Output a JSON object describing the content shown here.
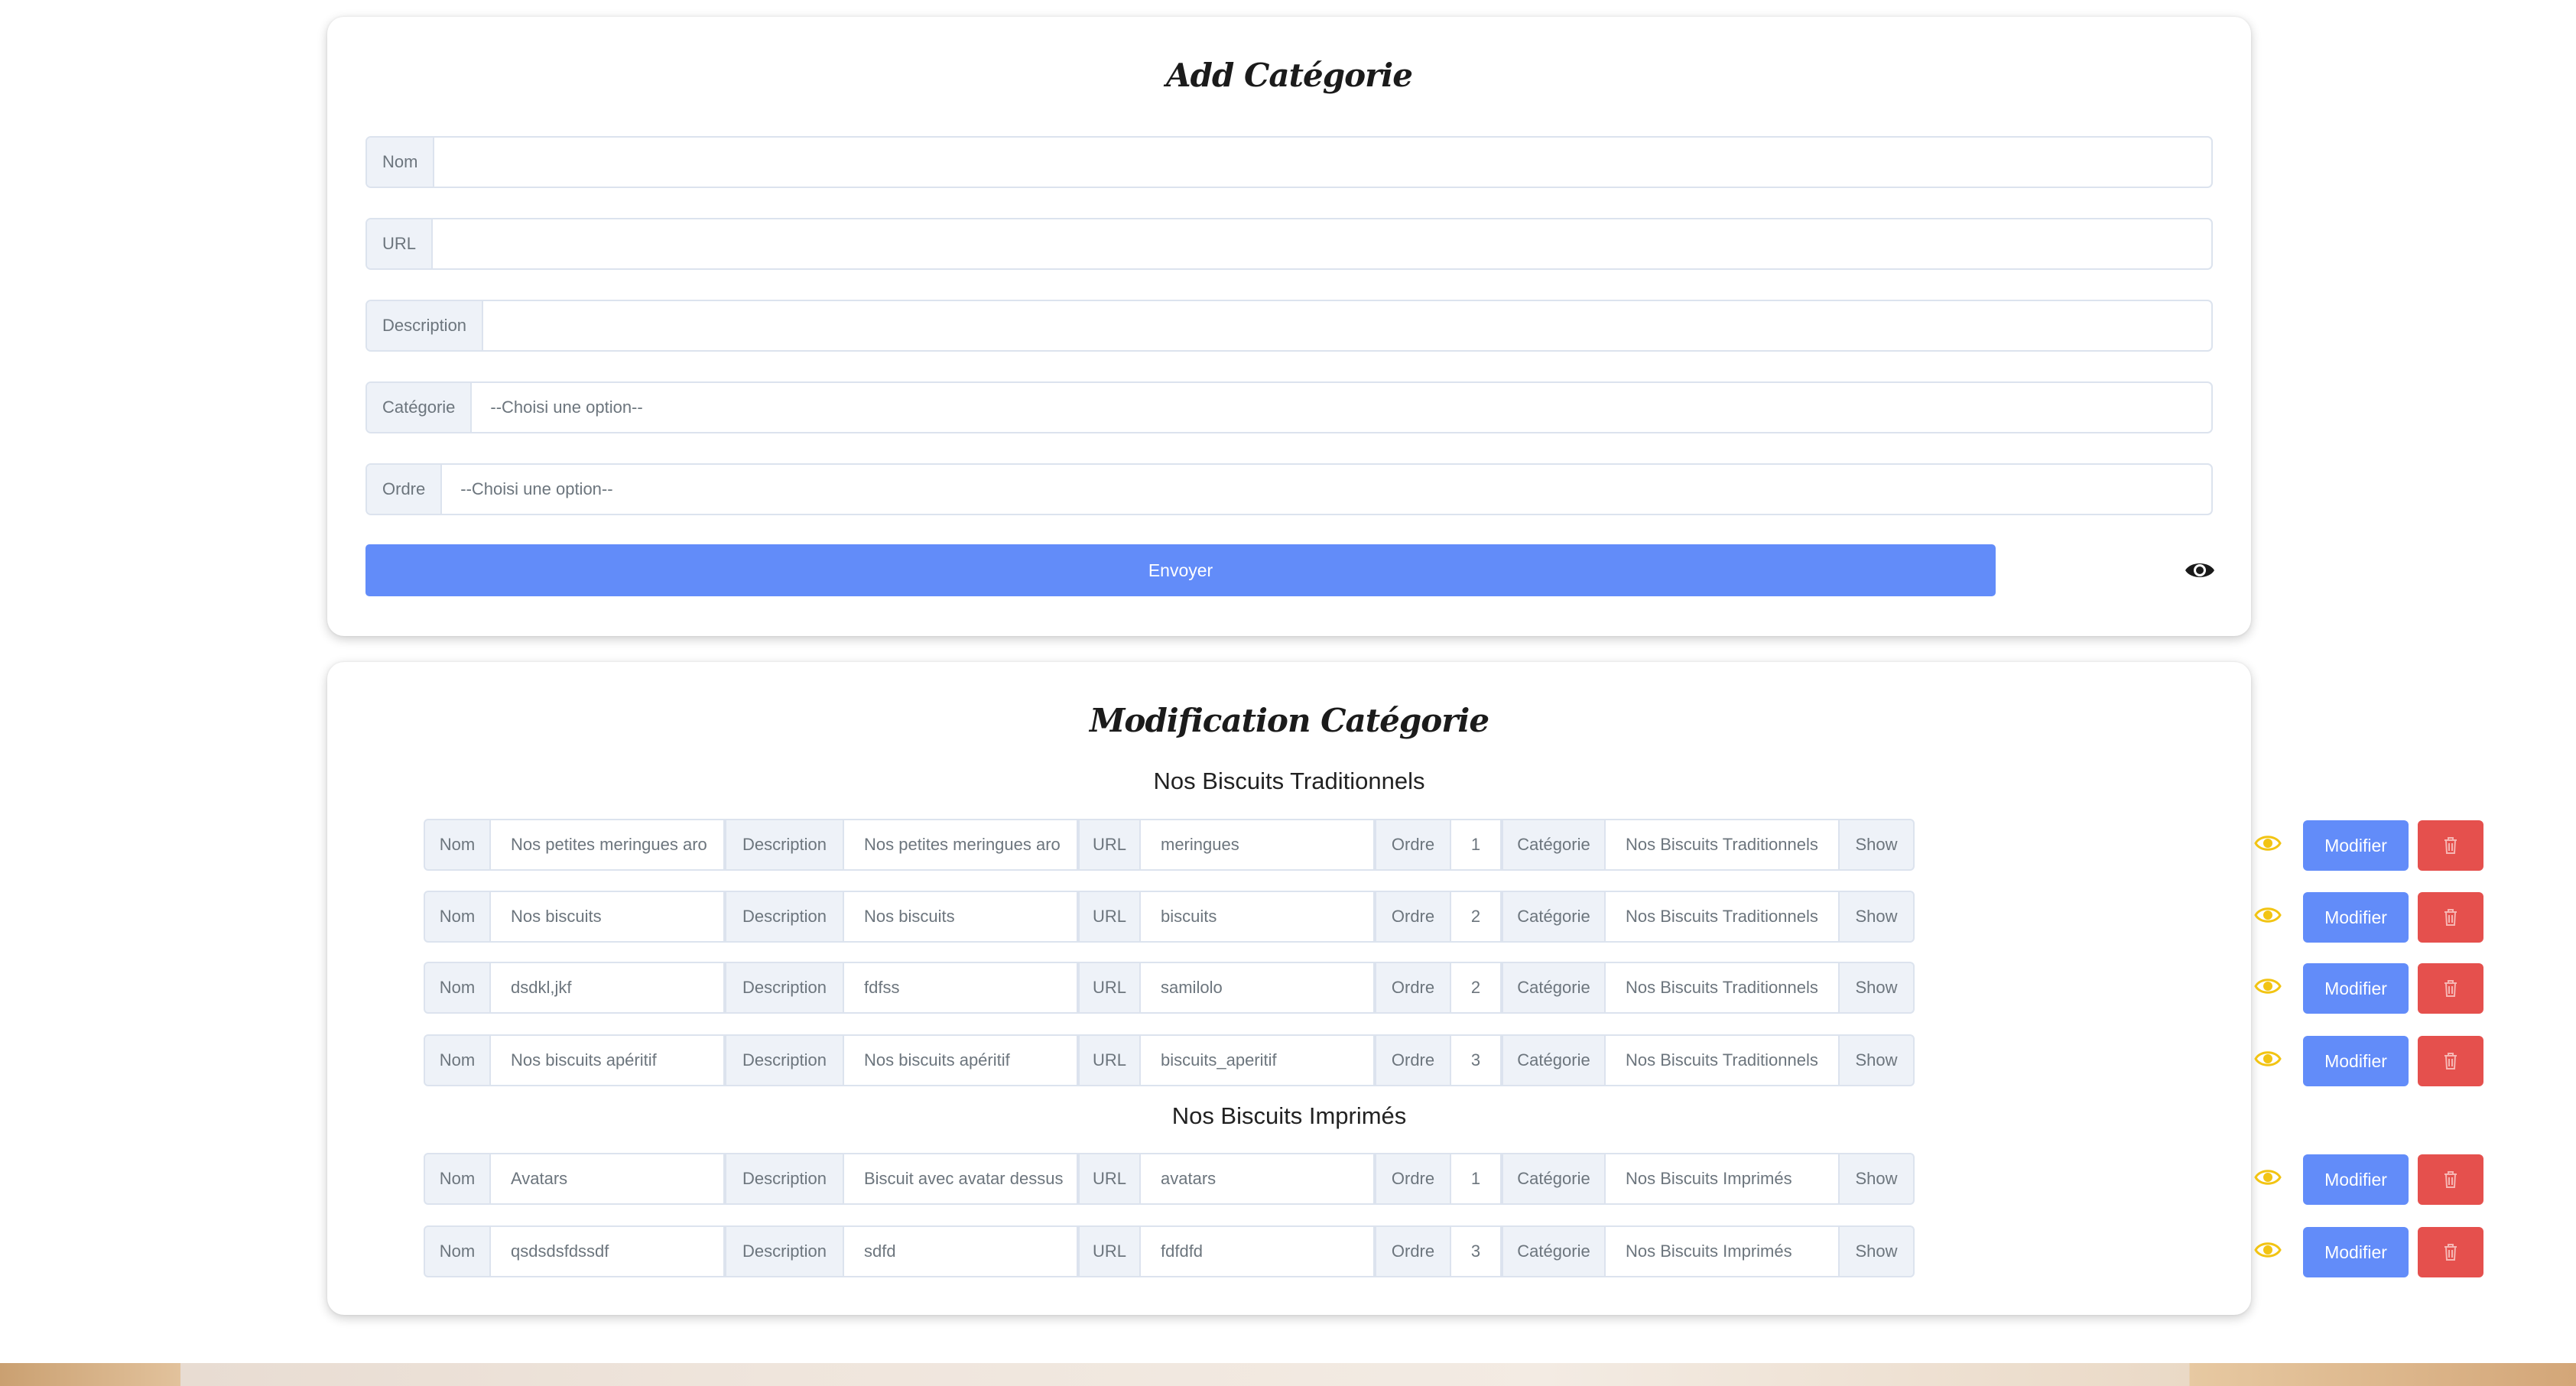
{
  "add_form": {
    "title": "Add Catégorie",
    "fields": [
      {
        "label": "Nom",
        "value": ""
      },
      {
        "label": "URL",
        "value": ""
      },
      {
        "label": "Description",
        "value": ""
      },
      {
        "label": "Catégorie",
        "value": "--Choisi une option--"
      },
      {
        "label": "Ordre",
        "value": "--Choisi une option--"
      }
    ],
    "submit_label": "Envoyer",
    "toggle_icon": "eye-icon"
  },
  "modification": {
    "title": "Modification Catégorie",
    "column_labels": {
      "nom": "Nom",
      "description": "Description",
      "url": "URL",
      "ordre": "Ordre",
      "categorie": "Catégorie",
      "show": "Show"
    },
    "modify_label": "Modifier",
    "delete_icon": "trash-icon",
    "show_icon": "eye-icon",
    "show_icon_color": "#f2c413",
    "groups": [
      {
        "name": "Nos Biscuits Traditionnels",
        "rows": [
          {
            "nom": "Nos petites meringues aro",
            "description": "Nos petites meringues aro",
            "url": "meringues",
            "ordre": "1",
            "categorie": "Nos Biscuits Traditionnels"
          },
          {
            "nom": "Nos biscuits",
            "description": "Nos biscuits",
            "url": "biscuits",
            "ordre": "2",
            "categorie": "Nos Biscuits Traditionnels"
          },
          {
            "nom": "dsdkl,jkf",
            "description": "fdfss",
            "url": "samilolo",
            "ordre": "2",
            "categorie": "Nos Biscuits Traditionnels"
          },
          {
            "nom": "Nos biscuits apéritif",
            "description": "Nos biscuits apéritif",
            "url": "biscuits_aperitif",
            "ordre": "3",
            "categorie": "Nos Biscuits Traditionnels"
          }
        ]
      },
      {
        "name": "Nos Biscuits Imprimés",
        "rows": [
          {
            "nom": "Avatars",
            "description": "Biscuit avec avatar dessus",
            "url": "avatars",
            "ordre": "1",
            "categorie": "Nos Biscuits Imprimés"
          },
          {
            "nom": "qsdsdsfdssdf",
            "description": "sdfd",
            "url": "fdfdfd",
            "ordre": "3",
            "categorie": "Nos Biscuits Imprimés"
          }
        ]
      }
    ]
  },
  "colors": {
    "primary": "#628cf9",
    "danger": "#e5504d",
    "label_bg": "#eef2f8",
    "border": "#dce3ee"
  }
}
